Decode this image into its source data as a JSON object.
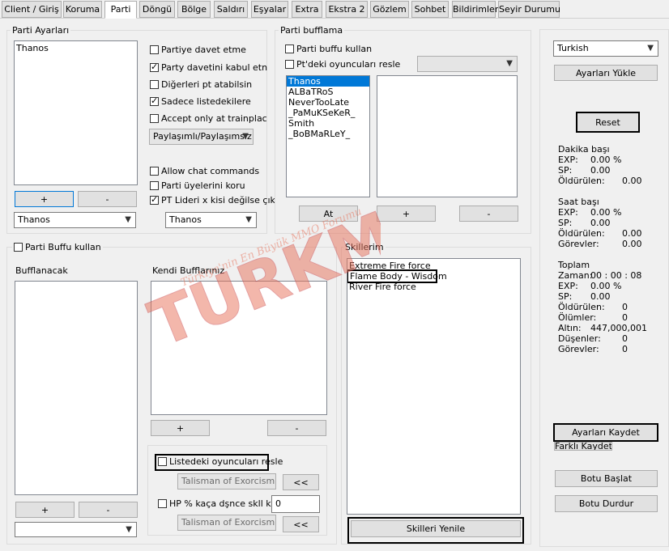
{
  "tabs": [
    "Client / Giriş",
    "Koruma",
    "Parti",
    "Döngü",
    "Bölge",
    "Saldırı",
    "Eşyalar",
    "Extra",
    "Ekstra 2",
    "Gözlem",
    "Sohbet",
    "Bildirimler",
    "Seyir Durumu"
  ],
  "parti_ayarlari": {
    "title": "Parti Ayarları",
    "list": [
      "Thanos"
    ],
    "add_label": "+",
    "remove_label": "-",
    "member_combo": "Thanos",
    "checks": {
      "invite": "Partiye davet etme",
      "accept": "Party davetini kabul etn",
      "others": "Diğerleri pt atabilsin",
      "only_list": "Sadece listedekilere",
      "trainplace": "Accept only at trainplac",
      "chat": "Allow chat commands",
      "protect": "Parti üyelerini koru",
      "leader": "PT Lideri x kisi değilse çık"
    },
    "share_combo": "Paylaşımlı/Paylaşımsız",
    "leader_combo": "Thanos"
  },
  "parti_bufflama": {
    "title": "Parti bufflama",
    "check_buff": "Parti buffu kullan",
    "check_resle": "Pt'deki oyuncuları resle",
    "players": [
      "Thanos",
      "ALBaTRoS",
      "NeverTooLate",
      "_PaMuKSeKeR_",
      "Smith",
      "_BoBMaRLeY_"
    ],
    "at_label": "At",
    "add_label": "+",
    "remove_label": "-"
  },
  "parti_buffu": {
    "check": "Parti Buffu kullan",
    "bufflanacak": "Bufflanacak",
    "kendi": "Kendi Bufflarınız",
    "add_label": "+",
    "remove_label": "-",
    "resle_check": "Listedeki oyuncuları resle",
    "talisman1": "Talisman of Exorcism",
    "arrow1": "<<",
    "hp_check": "HP % kaça dşnce skll kllr",
    "hp_value": "0",
    "talisman2": "Talisman of Exorcism",
    "arrow2": "<<"
  },
  "skillerim": {
    "title": "Skillerim",
    "skills": [
      "Extreme Fire force",
      "Flame Body - Wisdom",
      "River Fire force"
    ],
    "refresh_label": "Skilleri Yenile"
  },
  "right": {
    "language": "Turkish",
    "load_label": "Ayarları Yükle",
    "reset_label": "Reset",
    "dakika": {
      "title": "Dakika başı",
      "exp_label": "EXP:",
      "exp_value": "0.00 %",
      "sp_label": "SP:",
      "sp_value": "0.00",
      "kill_label": "Öldürülen:",
      "kill_value": "0.00"
    },
    "saat": {
      "title": "Saat başı",
      "exp_label": "EXP:",
      "exp_value": "0.00 %",
      "sp_label": "SP:",
      "sp_value": "0.00",
      "kill_label": "Öldürülen:",
      "kill_value": "0.00",
      "quest_label": "Görevler:",
      "quest_value": "0.00"
    },
    "toplam": {
      "title": "Toplam",
      "time_label": "Zaman:",
      "time_value": "00 : 00 : 08",
      "exp_label": "EXP:",
      "exp_value": "0.00 %",
      "sp_label": "SP:",
      "sp_value": "0.00",
      "kill_label": "Öldürülen:",
      "kill_value": "0",
      "death_label": "Ölümler:",
      "death_value": "0",
      "gold_label": "Altın:",
      "gold_value": "447,000,001",
      "drop_label": "Düşenler:",
      "drop_value": "0",
      "quest_label": "Görevler:",
      "quest_value": "0"
    },
    "save_label": "Ayarları Kaydet",
    "save_as_label": "Farklı Kaydet",
    "start_label": "Botu Başlat",
    "stop_label": "Botu Durdur"
  },
  "watermark": {
    "brand": "TURKMMO",
    "slogan": "Türkiye'nin En Büyük MMO Forumu"
  }
}
